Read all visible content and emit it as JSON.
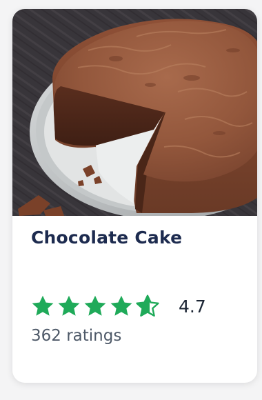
{
  "card": {
    "image": {
      "subject": "chocolate-cake-photo",
      "alt": "Chocolate cake on a metal plate with a slice removed"
    },
    "title": "Chocolate Cake",
    "rating": {
      "value": "4.7",
      "numeric": 4.7,
      "max": 5,
      "stars_filled": 4.7
    },
    "ratings_count": "362 ratings"
  },
  "colors": {
    "star": "#1faa59",
    "title": "#1d2b4f",
    "text": "#1b2433",
    "muted": "#4e5968",
    "cake": "#8a4e34"
  },
  "icons": {
    "star": "star-icon",
    "half_star": "star-half-icon"
  }
}
